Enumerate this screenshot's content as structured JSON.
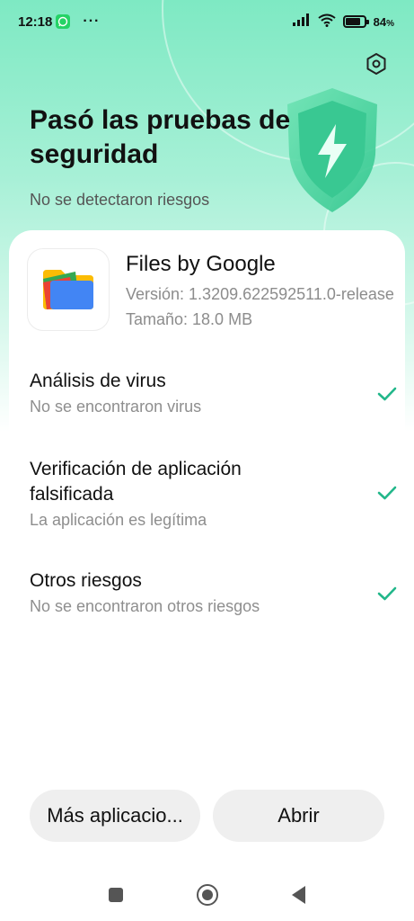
{
  "status_bar": {
    "time": "12:18",
    "more_dots": "···",
    "battery_text": "84",
    "battery_unit": "%",
    "battery_level": 0.84
  },
  "header": {
    "title": "Pasó las pruebas de seguridad",
    "subtitle": "No se detectaron riesgos"
  },
  "app": {
    "name": "Files by Google",
    "version": "Versión: 1.3209.622592511.0-release",
    "size": "Tamaño: 18.0 MB"
  },
  "checks": [
    {
      "title": "Análisis de virus",
      "subtitle": "No se encontraron virus"
    },
    {
      "title": "Verificación de aplicación falsificada",
      "subtitle": "La aplicación es legítima"
    },
    {
      "title": "Otros riesgos",
      "subtitle": "No se encontraron otros riesgos"
    }
  ],
  "buttons": {
    "more_apps": "Más aplicacio...",
    "open": "Abrir"
  },
  "colors": {
    "accent": "#22b78a",
    "hero_top": "#7ee9c3"
  },
  "icons": {
    "settings": "settings-icon",
    "shield": "shield-bolt-icon",
    "check": "check-icon"
  }
}
